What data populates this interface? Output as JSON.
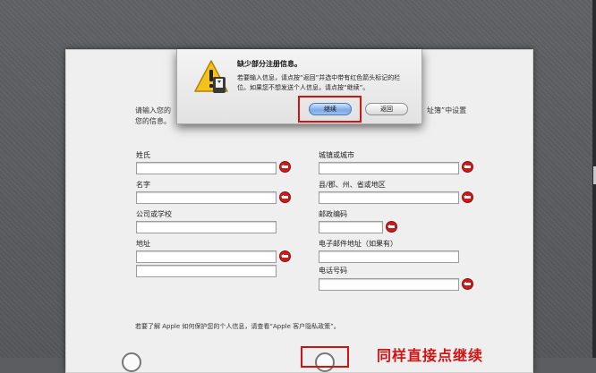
{
  "form": {
    "intro_line1": "请输入您的",
    "intro_line2": "您的信息。",
    "intro_right": "址簿”中设置",
    "fields_left": [
      {
        "label": "姓氏",
        "value": ""
      },
      {
        "label": "名字",
        "value": ""
      },
      {
        "label": "公司或学校",
        "value": ""
      },
      {
        "label": "地址",
        "value": ""
      },
      {
        "label": "",
        "value": ""
      }
    ],
    "fields_right": [
      {
        "label": "城镇或城市",
        "value": ""
      },
      {
        "label": "县/郡、州、省或地区",
        "value": ""
      },
      {
        "label": "邮政编码",
        "value": ""
      },
      {
        "label": "电子邮件地址（如果有）",
        "value": ""
      },
      {
        "label": "电话号码",
        "value": ""
      }
    ],
    "privacy_text": "若要了解 Apple 如何保护您的个人信息，请查看“Apple 客户隐私政策”。"
  },
  "dialog": {
    "title": "缺少部分注册信息。",
    "message": "若要输入信息，请点按“返回”并选中带有红色箭头标记的栏位。如果您不想发送个人信息，请点按“继续”。",
    "continue_label": "继续",
    "back_label": "返回"
  },
  "annotation": {
    "text": "同样直接点继续",
    "color": "#d01414"
  },
  "colors": {
    "background": "#5b5d60",
    "warning_red": "#cc1b1b",
    "primary_button": "#7ca9e6"
  }
}
